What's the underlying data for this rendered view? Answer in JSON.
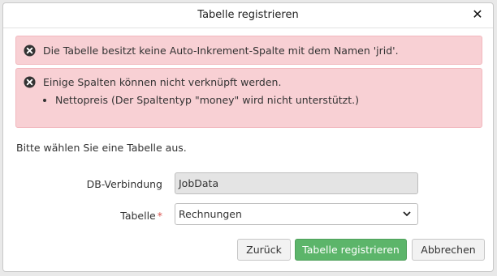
{
  "dialog": {
    "title": "Tabelle registrieren",
    "close_icon": "close-icon"
  },
  "alerts": [
    {
      "icon": "error-circle-icon",
      "text": "Die Tabelle besitzt keine Auto-Inkrement-Spalte mit dem Namen 'jrid'."
    },
    {
      "icon": "error-circle-icon",
      "text": "Einige Spalten können nicht verknüpft werden.",
      "items": [
        "Nettopreis (Der Spaltentyp \"money\" wird nicht unterstützt.)"
      ]
    }
  ],
  "instruction": "Bitte wählen Sie eine Tabelle aus.",
  "form": {
    "db_label": "DB-Verbindung",
    "db_value": "JobData",
    "table_label": "Tabelle",
    "table_required_marker": "*",
    "table_value": "Rechnungen"
  },
  "buttons": {
    "back": "Zurück",
    "register": "Tabelle registrieren",
    "cancel": "Abbrechen"
  },
  "colors": {
    "alert_bg": "#f8d0d4",
    "primary_button": "#5cb56a",
    "required": "#d9534f"
  }
}
